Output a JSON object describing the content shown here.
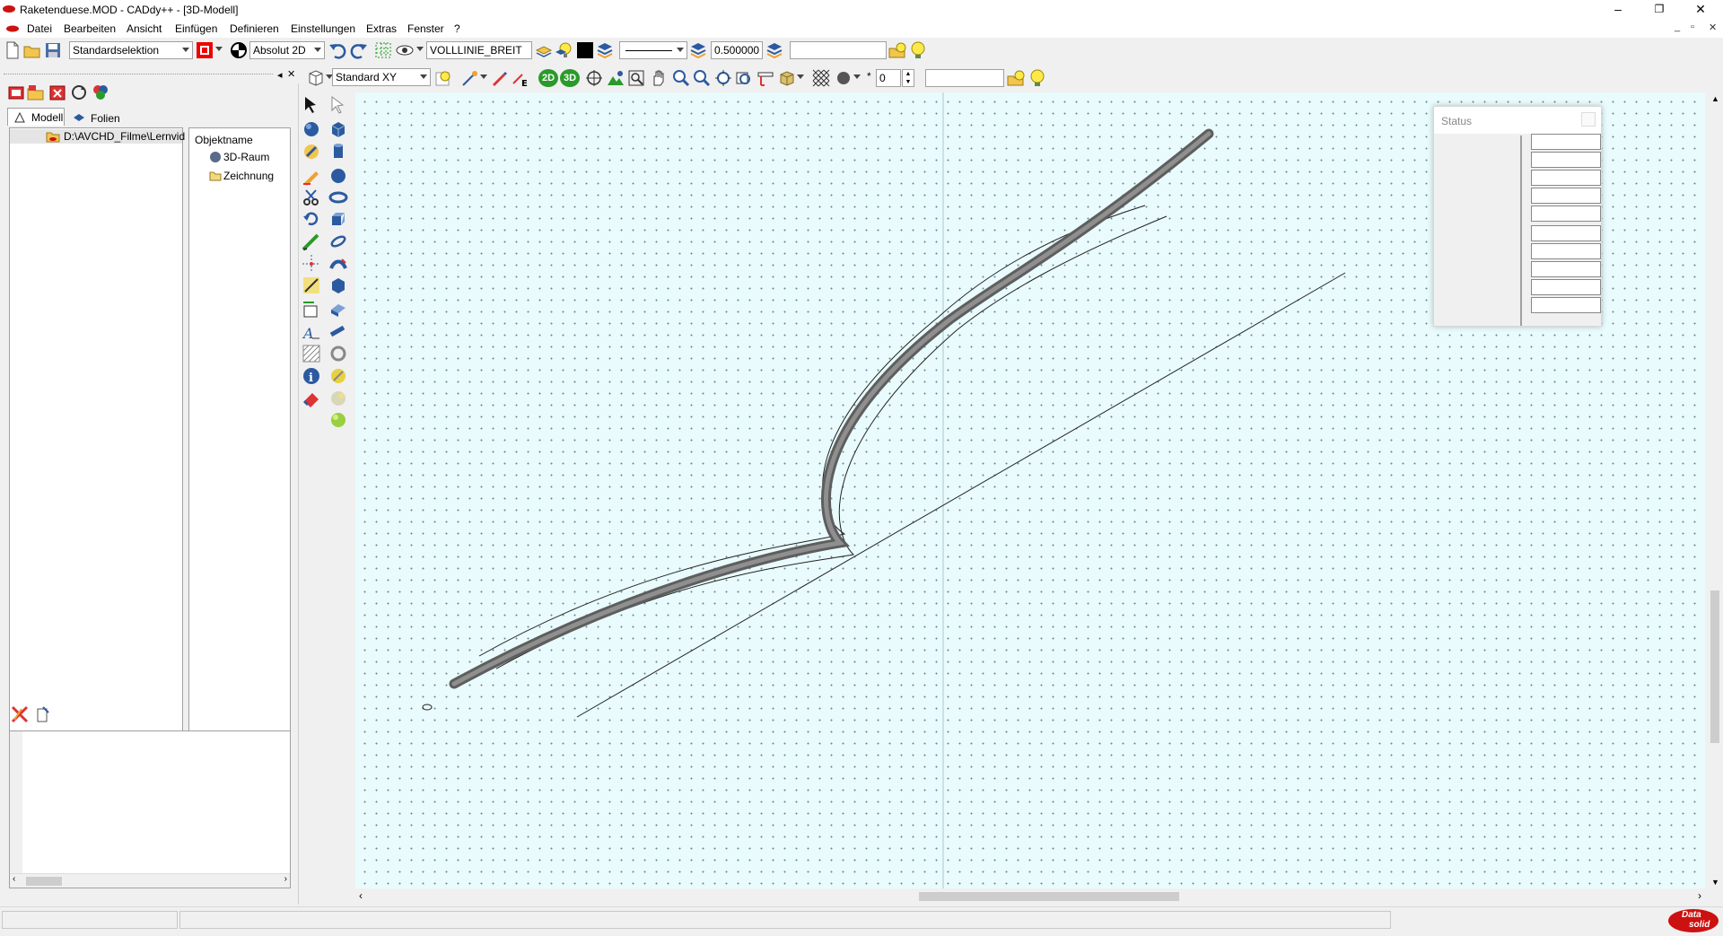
{
  "window": {
    "title": "Raketenduese.MOD  -  CADdy++ - [3D-Modell]",
    "controls": {
      "minimize": "–",
      "restore": "❐",
      "close": "✕"
    }
  },
  "menu": {
    "items": [
      "Datei",
      "Bearbeiten",
      "Ansicht",
      "Einfügen",
      "Definieren",
      "Einstellungen",
      "Extras",
      "Fenster",
      "?"
    ]
  },
  "toolbar1": {
    "selection_mode": "Standardselektion",
    "coord_mode": "Absolut 2D",
    "line_type_name": "VOLLLINIE_BREIT",
    "line_width": "0.500000",
    "extra_field": ""
  },
  "toolbar2": {
    "view": "Standard XY",
    "btn_2d": "2D",
    "btn_3d": "3D",
    "counter": "0",
    "extra_field": ""
  },
  "left_panel": {
    "tabs": [
      "Modell",
      "Folien"
    ],
    "path": "D:\\AVCHD_Filme\\Lernvid",
    "column_header": "Objektname",
    "objects": [
      "3D-Raum",
      "Zeichnung"
    ]
  },
  "status_panel": {
    "title": "Status",
    "rows": 10
  },
  "brand": {
    "logo_top": "Data",
    "logo_bottom": "solid",
    "logo_color": "#cc1111"
  },
  "colors": {
    "canvas_bg": "#e9fbfc",
    "tube": "#7a7a7a"
  }
}
